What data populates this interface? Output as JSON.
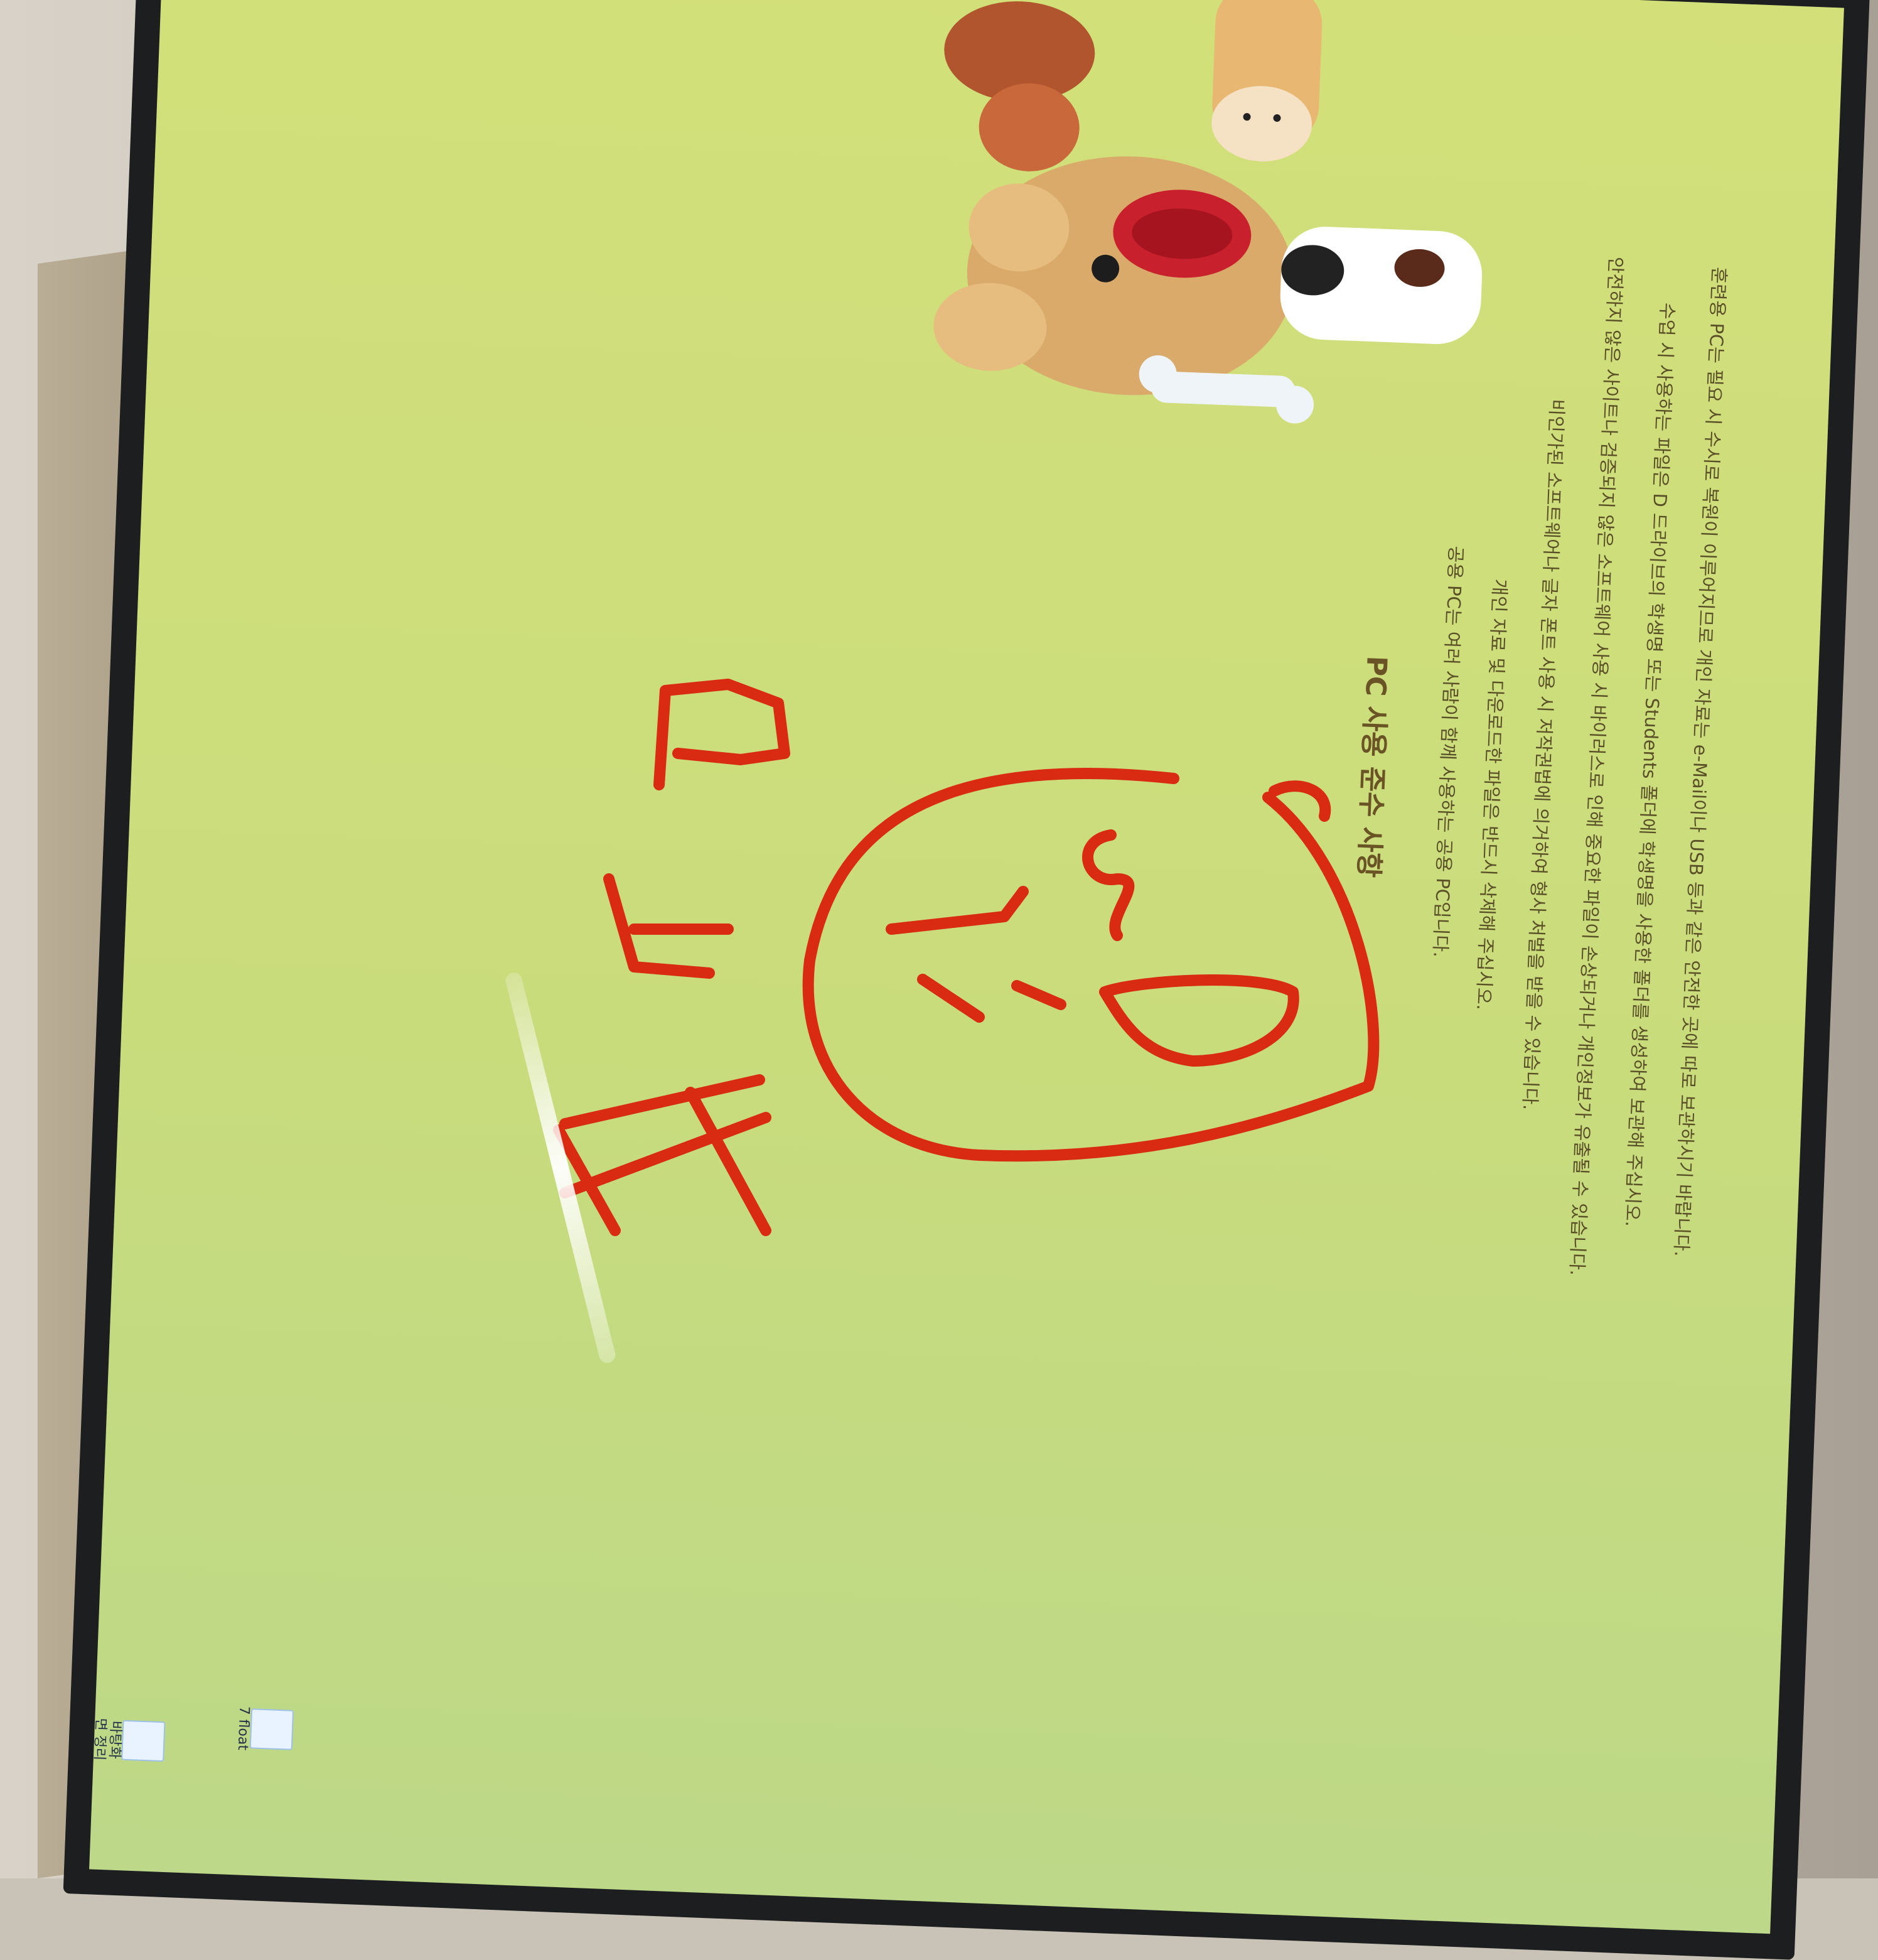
{
  "notice": {
    "title": "PC 사용 준수 사항",
    "lines": [
      "공용 PC는 여러 사람이 함께 사용하는 공용 PC입니다.",
      "개인 자료 및 다운로드한 파일은 반드시 삭제해 주십시오.",
      "비인가된 소프트웨어나 글자 폰트 사용 시 저작권법에 의거하여 형사 처벌을 받을 수 있습니다.",
      "안전하지 않은 사이트나 검증되지 않은 소프트웨어 사용 시 바이러스로 인해 중요한 파일이 손상되거나 개인정보가 유출될 수 있습니다.",
      "수업 시 사용하는 파일은 D 드라이브의 학생명 또는 Students 폴더에 학생명을 사용한 폴더를 생성하여 보관해 주십시오.",
      "훈련용 PC는 필요 시 수시로 복원이 이루어지므로 개인 자료는 e-Mail이나 USB 등과 같은 안전한 곳에 따로 보관하시기 바랍니다."
    ]
  },
  "desktop_icons": [
    {
      "label": "바탕화면 정리 최종본..."
    },
    {
      "label": "7 float"
    }
  ],
  "colors": {
    "wallpaper": "#cddd7c",
    "ink": "#d92a12",
    "bezel": "#1c1e1f"
  },
  "icons": [
    "folder-icon",
    "folder-icon"
  ]
}
